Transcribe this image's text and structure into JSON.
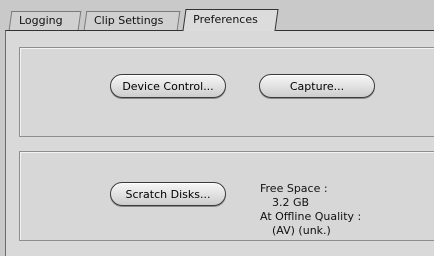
{
  "tabs": [
    {
      "label": "Logging"
    },
    {
      "label": "Clip Settings"
    },
    {
      "label": "Preferences"
    }
  ],
  "buttons": {
    "device_control": "Device Control...",
    "capture": "Capture...",
    "scratch_disks": "Scratch Disks..."
  },
  "info": {
    "free_space_label": "Free Space :",
    "free_space_value": "3.2 GB",
    "quality_label": "At Offline Quality :",
    "quality_value": "(AV) (unk.)"
  }
}
